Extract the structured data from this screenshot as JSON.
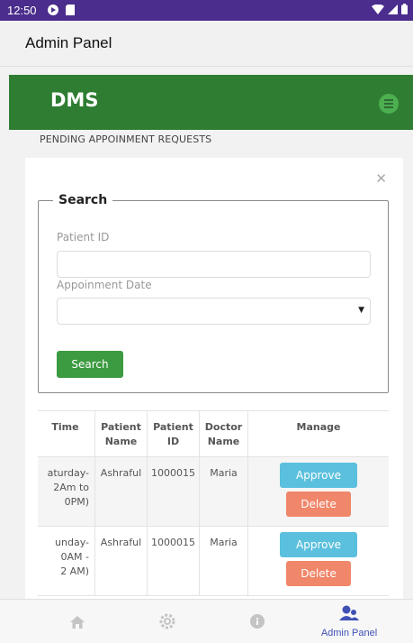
{
  "status_bar": {
    "time": "12:50",
    "icons": [
      "app-notification-icon",
      "sim-card-icon",
      "wifi-icon",
      "signal-icon",
      "battery-icon"
    ]
  },
  "app_bar": {
    "title": "Admin Panel"
  },
  "navbar": {
    "brand": "DMS"
  },
  "page": {
    "section_title": "PENDING APPOINMENT REQUESTS"
  },
  "search_form": {
    "legend": "Search",
    "patient_id_label": "Patient ID",
    "patient_id_value": "",
    "appointment_date_label": "Appoinment Date",
    "appointment_date_value": "",
    "submit_label": "Search"
  },
  "table": {
    "headers": [
      "Time",
      "Patient Name",
      "Patient ID",
      "Doctor Name",
      "Manage"
    ],
    "rows": [
      {
        "time": "aturday-\n2Am to\n0PM)",
        "patient_name": "Ashraful",
        "patient_id": "1000015",
        "doctor_name": "Maria",
        "approve_label": "Approve",
        "delete_label": "Delete"
      },
      {
        "time": "unday-\n0AM -\n2 AM)",
        "patient_name": "Ashraful",
        "patient_id": "1000015",
        "doctor_name": "Maria",
        "approve_label": "Approve",
        "delete_label": "Delete"
      }
    ]
  },
  "bottom_nav": {
    "items": [
      {
        "icon": "home-icon",
        "label": ""
      },
      {
        "icon": "settings-icon",
        "label": ""
      },
      {
        "icon": "info-icon",
        "label": ""
      },
      {
        "icon": "admin-users-icon",
        "label": "Admin Panel"
      }
    ],
    "active_color": "#3f51b5"
  },
  "colors": {
    "status_bar": "#4a2d8c",
    "navbar": "#2f7d32",
    "search_button": "#3c9a40",
    "approve_button": "#5bc0de",
    "delete_button": "#f0866a"
  }
}
